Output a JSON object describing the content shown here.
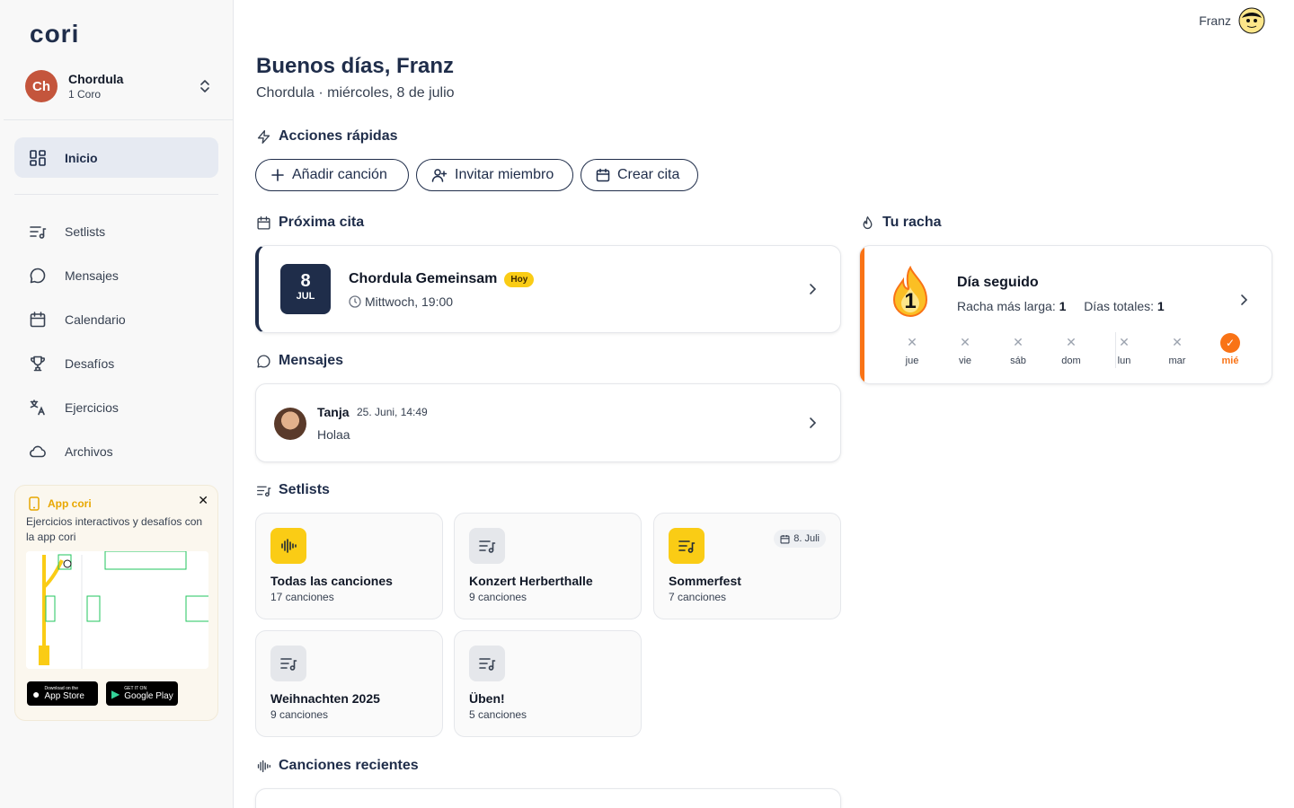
{
  "brand": {
    "logo": "cori"
  },
  "choir": {
    "initials": "Ch",
    "name": "Chordula",
    "sub": "1 Coro"
  },
  "nav": {
    "active": "Inicio",
    "items": [
      "Setlists",
      "Mensajes",
      "Calendario",
      "Desafíos",
      "Ejercicios",
      "Archivos"
    ]
  },
  "promo": {
    "title": "App cori",
    "text": "Ejercicios interactivos y desafíos con la app cori",
    "appstore_small": "Download on the",
    "appstore_big": "App Store",
    "googleplay_small": "GET IT ON",
    "googleplay_big": "Google Play"
  },
  "user": {
    "name": "Franz"
  },
  "header": {
    "greeting": "Buenos días, Franz",
    "subtitle": "Chordula · miércoles, 8 de julio"
  },
  "quick_actions": {
    "title": "Acciones rápidas",
    "add_song": "Añadir canción",
    "invite_member": "Invitar miembro",
    "create_event": "Crear cita"
  },
  "next_event": {
    "title": "Próxima cita",
    "day": "8",
    "month": "JUL",
    "name": "Chordula Gemeinsam",
    "badge": "Hoy",
    "time": "Mittwoch, 19:00"
  },
  "messages": {
    "title": "Mensajes",
    "sender": "Tanja",
    "date": "25. Juni, 14:49",
    "text": "Holaa"
  },
  "streak": {
    "title": "Tu racha",
    "count": "1",
    "status": "Día seguido",
    "longest_label": "Racha más larga:",
    "longest_value": "1",
    "total_label": "Días totales:",
    "total_value": "1",
    "days": [
      "jue",
      "vie",
      "sáb",
      "dom",
      "lun",
      "mar",
      "mié"
    ],
    "today": "mié",
    "accent": "#f97316"
  },
  "setlists": {
    "title": "Setlists",
    "items": [
      {
        "name": "Todas las canciones",
        "count": "17 canciones"
      },
      {
        "name": "Konzert Herberthalle",
        "count": "9 canciones"
      },
      {
        "name": "Sommerfest",
        "count": "7 canciones",
        "date": "8. Juli"
      },
      {
        "name": "Weihnachten 2025",
        "count": "9 canciones"
      },
      {
        "name": "Üben!",
        "count": "5 canciones"
      }
    ]
  },
  "recent_songs": {
    "title": "Canciones recientes"
  },
  "colors": {
    "primary": "#1f2d4a",
    "accent_yellow": "#facc15",
    "choir_avatar": "#c4553c"
  }
}
